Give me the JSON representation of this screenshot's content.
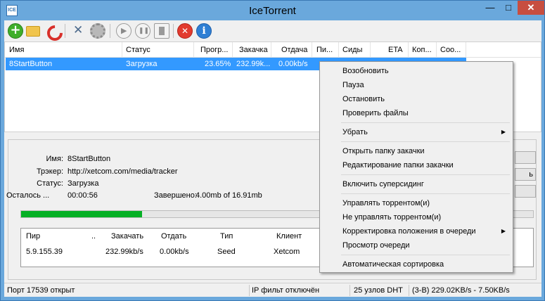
{
  "window": {
    "title": "IceTorrent",
    "icon_text": "ICE",
    "minimize": "—",
    "maximize": "□",
    "close": "✕"
  },
  "toolbar": {
    "icons": [
      "add-torrent-icon",
      "open-folder-icon",
      "magnet-icon",
      "settings-tools-icon",
      "preferences-gear-icon",
      "resume-icon",
      "pause-icon",
      "stop-icon",
      "remove-icon",
      "info-icon"
    ]
  },
  "list": {
    "columns": [
      "Имя",
      "Статус",
      "Прогр...",
      "Закачка",
      "Отдача",
      "Пи...",
      "Сиды",
      "ETA",
      "Коп...",
      "Соо..."
    ],
    "rows": [
      {
        "name": "8StartButton",
        "status": "Загрузка",
        "progress": "23.65%",
        "download": "232.99k...",
        "upload": "0.00kb/s"
      }
    ]
  },
  "details": {
    "name_label": "Имя:",
    "name": "8StartButton",
    "tracker_label": "Трэкер:",
    "tracker": "http://xetcom.com/media/tracker",
    "status_label": "Статус:",
    "status": "Загрузка",
    "remaining_label": "Осталось ...",
    "remaining": "00:00:56",
    "done_label": "Завершено:",
    "done": "4.00mb of 16.91mb",
    "progress_fraction": 0.2365,
    "side_btn": "ь"
  },
  "peers": {
    "columns": [
      "Пир",
      "..",
      "Закачать",
      "Отдать",
      "Тип",
      "Клиент"
    ],
    "rows": [
      {
        "peer": "5.9.155.39",
        "download": "232.99kb/s",
        "upload": "0.00kb/s",
        "type": "Seed",
        "client": "Xetcom"
      }
    ]
  },
  "statusbar": {
    "port": "Порт 17539 открыт",
    "ipfilter": "IP фильт отключён",
    "dht": "25 узлов DHT",
    "speeds": "(3-B) 229.02KB/s - 7.50KB/s"
  },
  "context_menu": {
    "items": [
      {
        "label": "Возобновить"
      },
      {
        "label": "Пауза"
      },
      {
        "label": "Остановить"
      },
      {
        "label": "Проверить файлы"
      },
      {
        "label": "Убрать",
        "submenu": "▶"
      },
      {
        "label": "Открыть папку закачки"
      },
      {
        "label": "Редактирование папки закачки"
      },
      {
        "label": "Включить суперсидинг"
      },
      {
        "label": "Управлять торрентом(и)"
      },
      {
        "label": "Не управлять торрентом(и)"
      },
      {
        "label": "Корректировка положения в очереди",
        "submenu": "▶"
      },
      {
        "label": "Просмотр очереди"
      },
      {
        "label": "Автоматическая сортировка"
      }
    ]
  },
  "colors": {
    "titlebar": "#6aa8dc",
    "selection": "#3399ff",
    "progress_fill": "#06b025",
    "close_button": "#c74e40"
  }
}
